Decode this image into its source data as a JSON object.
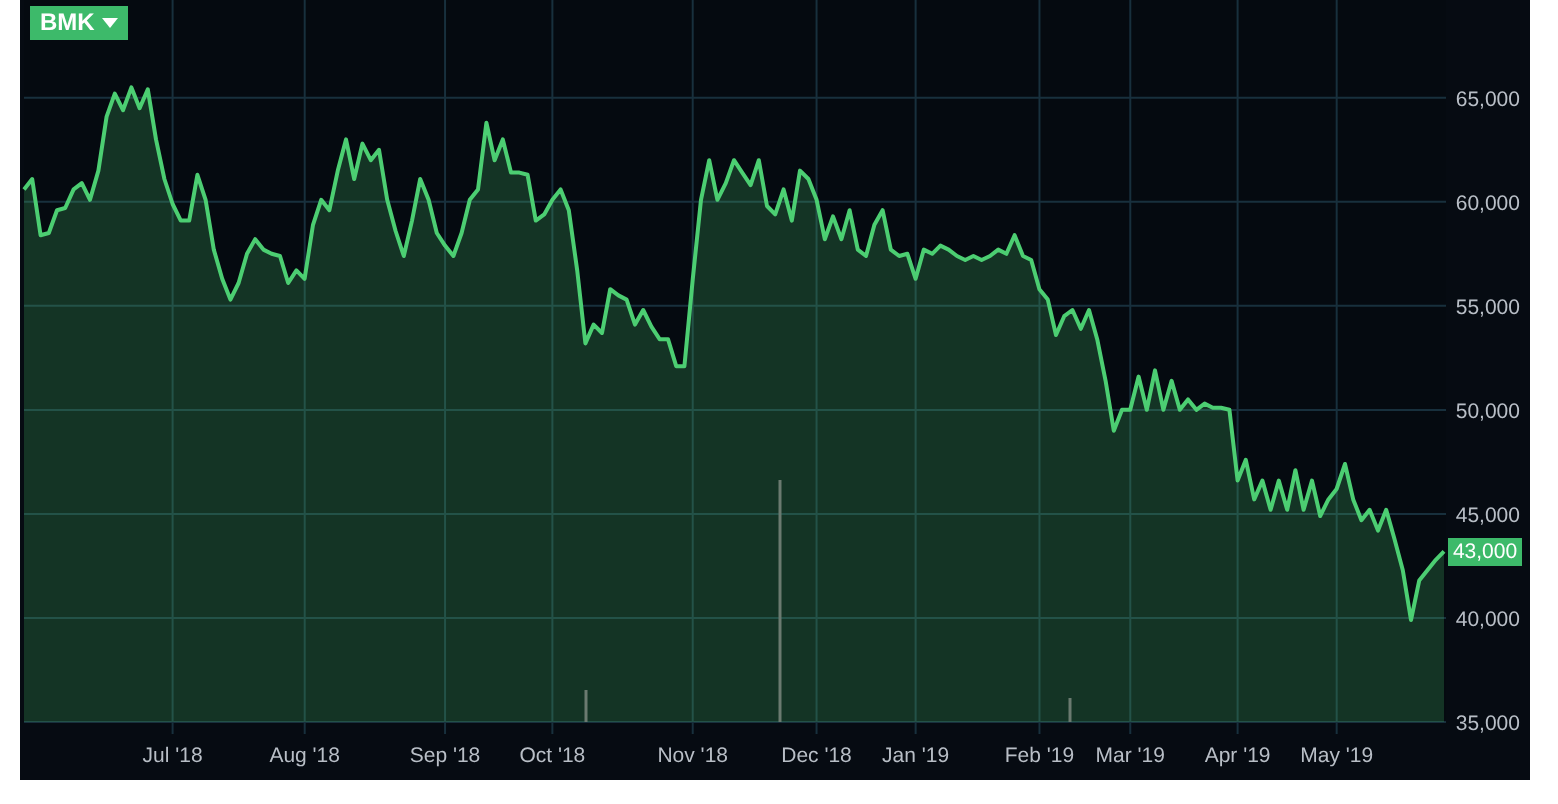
{
  "chart": {
    "chart_data": {
      "type": "area",
      "grid": true,
      "categories": [
        null,
        null,
        null,
        null,
        null,
        null,
        null,
        null,
        null,
        null,
        null,
        null,
        null,
        null,
        null,
        null,
        null,
        null,
        "Jul '18",
        null,
        null,
        null,
        null,
        null,
        null,
        null,
        null,
        null,
        null,
        null,
        null,
        null,
        null,
        null,
        "Aug '18",
        null,
        null,
        null,
        null,
        null,
        null,
        null,
        null,
        null,
        null,
        null,
        null,
        null,
        null,
        null,
        null,
        "Sep '18",
        null,
        null,
        null,
        null,
        null,
        null,
        null,
        null,
        null,
        null,
        null,
        null,
        "Oct '18",
        null,
        null,
        null,
        null,
        null,
        null,
        null,
        null,
        null,
        null,
        null,
        null,
        null,
        null,
        null,
        null,
        "Nov '18",
        null,
        null,
        null,
        null,
        null,
        null,
        null,
        null,
        null,
        null,
        null,
        null,
        null,
        null,
        "Dec '18",
        null,
        null,
        null,
        null,
        null,
        null,
        null,
        null,
        null,
        null,
        null,
        "Jan '19",
        null,
        null,
        null,
        null,
        null,
        null,
        null,
        null,
        null,
        null,
        null,
        null,
        null,
        null,
        "Feb '19",
        null,
        null,
        null,
        null,
        null,
        null,
        null,
        null,
        null,
        null,
        "Mar '19",
        null,
        null,
        null,
        null,
        null,
        null,
        null,
        null,
        null,
        null,
        null,
        null,
        "Apr '19",
        null,
        null,
        null,
        null,
        null,
        null,
        null,
        null,
        null,
        null,
        null,
        "May '19",
        null,
        null,
        null,
        null,
        null,
        null,
        null,
        null,
        null,
        null,
        null,
        null,
        null
      ],
      "series": [
        {
          "name": "BMK",
          "color": "#4cce72",
          "values": [
            60600,
            61100,
            58400,
            58500,
            59600,
            59700,
            60600,
            60900,
            60100,
            61500,
            64100,
            65200,
            64400,
            65500,
            64500,
            65400,
            63000,
            61100,
            59900,
            59100,
            59100,
            61300,
            60100,
            57700,
            56300,
            55300,
            56100,
            57500,
            58200,
            57700,
            57500,
            57400,
            56100,
            56700,
            56300,
            58900,
            60100,
            59600,
            61500,
            63000,
            61100,
            62800,
            62000,
            62500,
            60100,
            58600,
            57400,
            59100,
            61100,
            60100,
            58500,
            57900,
            57400,
            58500,
            60100,
            60600,
            63800,
            62000,
            63000,
            61400,
            61400,
            61300,
            59100,
            59400,
            60100,
            60600,
            59600,
            56700,
            53200,
            54100,
            53700,
            55800,
            55500,
            55300,
            54100,
            54800,
            54000,
            53400,
            53400,
            52100,
            52100,
            56300,
            60100,
            62000,
            60100,
            60900,
            62000,
            61400,
            60800,
            62000,
            59800,
            59400,
            60600,
            59100,
            61500,
            61100,
            60100,
            58200,
            59300,
            58200,
            59600,
            57700,
            57400,
            58900,
            59600,
            57700,
            57400,
            57500,
            56300,
            57700,
            57500,
            57900,
            57700,
            57400,
            57200,
            57400,
            57200,
            57400,
            57700,
            57500,
            58400,
            57400,
            57200,
            55800,
            55300,
            53600,
            54500,
            54800,
            53900,
            54800,
            53400,
            51400,
            49000,
            50000,
            50000,
            51600,
            50000,
            51900,
            50000,
            51400,
            50000,
            50500,
            50000,
            50300,
            50100,
            50100,
            50000,
            46600,
            47600,
            45700,
            46600,
            45200,
            46600,
            45200,
            47100,
            45200,
            46600,
            44900,
            45700,
            46200,
            47400,
            45700,
            44700,
            45200,
            44200,
            45200,
            43800,
            42300,
            39900,
            41800,
            42300,
            42800,
            43200
          ]
        }
      ],
      "ylim": [
        35000,
        69700
      ],
      "yticks": [
        {
          "value": 35000,
          "label": "35,000"
        },
        {
          "value": 40000,
          "label": "40,000"
        },
        {
          "value": 45000,
          "label": "45,000"
        },
        {
          "value": 50000,
          "label": "50,000"
        },
        {
          "value": 55000,
          "label": "55,000"
        },
        {
          "value": 60000,
          "label": "60,000"
        },
        {
          "value": 65000,
          "label": "65,000"
        }
      ]
    }
  },
  "last_price_badge": "43,000"
}
